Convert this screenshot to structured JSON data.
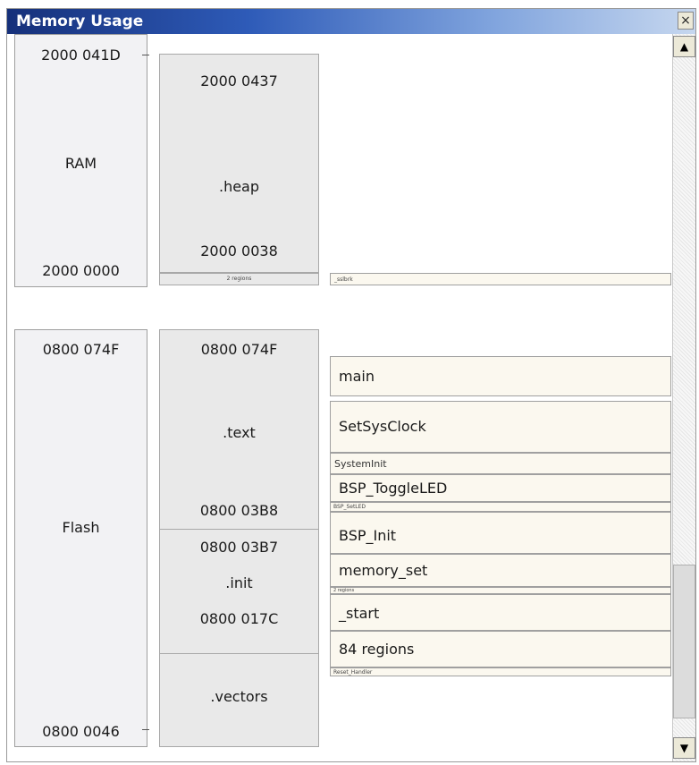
{
  "window": {
    "title": "Memory Usage",
    "close_glyph": "×"
  },
  "ram": {
    "top_address": "2000 041D",
    "label": "RAM",
    "bottom_address": "2000 0000",
    "heap": {
      "top": "2000 0437",
      "name": ".heap",
      "bottom": "2000 0038"
    },
    "regions_note": "2 regions",
    "side_note": "_sslbrk"
  },
  "flash": {
    "top_address": "0800 074F",
    "label": "Flash",
    "bottom_address": "0800 0046",
    "text": {
      "top": "0800 074F",
      "name": ".text",
      "bottom": "0800 03B8"
    },
    "init": {
      "top": "0800 03B7",
      "name": ".init",
      "bottom": "0800 017C"
    },
    "vectors": {
      "name": ".vectors"
    }
  },
  "functions": {
    "main": "main",
    "setsysclock": "SetSysClock",
    "systeminit": "SystemInit",
    "toggleled": "BSP_ToggleLED",
    "setled": "BSP_SetLED",
    "bsp_init": "BSP_Init",
    "memory_set": "memory_set",
    "regions_small": "2 regions",
    "start": "_start",
    "regions_84": "84 regions",
    "reset_handler": "Reset_Handler"
  },
  "scrollbar": {
    "up_glyph": "▲",
    "down_glyph": "▼"
  }
}
